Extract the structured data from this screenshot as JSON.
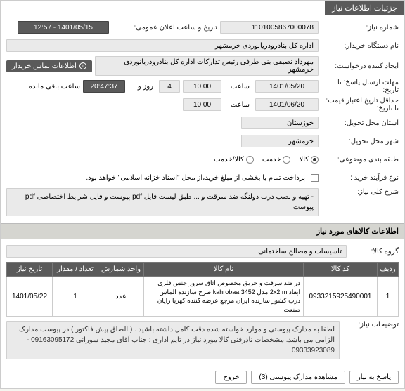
{
  "header_tab": "جزئیات اطلاعات نیاز",
  "fields": {
    "need_no_label": "شماره نیاز:",
    "need_no": "1101005867000078",
    "public_time_label": "تاریخ و ساعت اعلان عمومی:",
    "public_time": "1401/05/15 - 12:57",
    "buyer_label": "نام دستگاه خریدار:",
    "buyer": "اداره کل بنادرودریانوردی خرمشهر",
    "requester_label": "ایجاد کننده درخواست:",
    "requester": "مهرداد  نصیفی بنی طرفی رئیس تدارکات اداره کل بنادرودریانوردی خرمشهر",
    "contact_btn": "اطلاعات تماس خریدار",
    "deadline_label": "مهلت ارسال پاسخ: تا تاریخ:",
    "deadline_date": "1401/05/20",
    "time_label": "ساعت",
    "deadline_time": "10:00",
    "days_remain": "4",
    "days_label": "روز و",
    "time_remain": "20:47:37",
    "remain_label": "ساعت باقی مانده",
    "validity_label": "حداقل تاریخ اعتبار قیمت: تا تاریخ:",
    "validity_date": "1401/06/20",
    "validity_time": "10:00",
    "province_label": "استان محل تحویل:",
    "province": "خوزستان",
    "city_label": "شهر محل تحویل:",
    "city": "خرمشهر",
    "category_label": "طبقه بندی موضوعی:",
    "cat_goods": "کالا",
    "cat_service": "خدمت",
    "cat_goods_service": "کالا/خدمت",
    "process_label": "نوع فرآیند خرید :",
    "process_note_check": "",
    "process_note": "پرداخت تمام یا بخشی از مبلغ خرید،از محل \"اسناد خزانه اسلامی\" خواهد بود.",
    "desc_label": "شرح کلی نیاز:",
    "desc": "- تهیه و نصب درب دولنگه ضد سرقت و ... طبق لیست فایل pdf  پیوست و فایل شرایط اختصاصی pdf پیوست",
    "items_title": "اطلاعات کالاهای مورد نیاز",
    "group_label": "گروه کالا:",
    "group": "تاسیسات و مصالح ساختمانی"
  },
  "table": {
    "headers": [
      "ردیف",
      "کد کالا",
      "نام کالا",
      "واحد شمارش",
      "تعداد / مقدار",
      "تاریخ نیاز"
    ],
    "rows": [
      {
        "idx": "1",
        "code": "0933215925490001",
        "name": "در ضد سرقت و حریق مخصوص اتاق سرور جنس فلزی ابعاد 2x2 m مدل kahrobaa 3452 طرح سازنده الماس درب کشور سازنده ایران مرجع عرضه کننده کهربا رایان صنعت",
        "unit": "عدد",
        "qty": "1",
        "date": "1401/05/22"
      }
    ]
  },
  "need_notes_label": "توضیحات نیاز:",
  "need_notes": "لطفا به مدارک پیوستی و موارد خواسته شده دقت کامل داشته باشید . ( الصاق پیش فاکتور ) در پیوست مدارک الزامی  می باشد. مشخصات نادرفنی کالا مورد نیاز در تایم اداری : جناب آقای مجید سورانی 09163095172 - 09333923089",
  "footer": {
    "reply": "پاسخ به نیاز",
    "attachments": "مشاهده مدارک پیوستی (3)",
    "close": "خروج"
  }
}
